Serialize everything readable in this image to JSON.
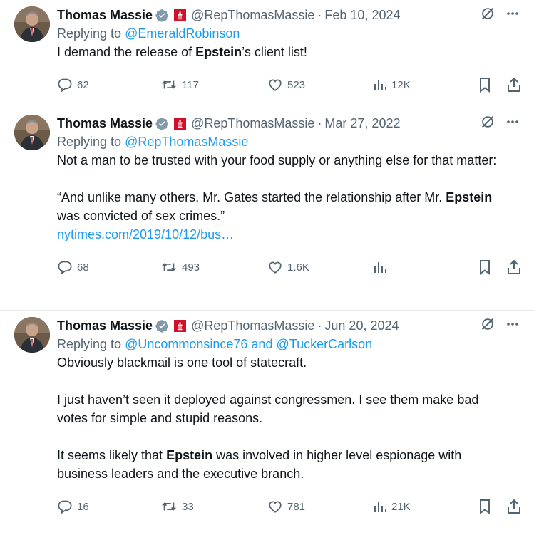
{
  "tweets": [
    {
      "name": "Thomas Massie",
      "handle": "@RepThomasMassie",
      "sep": "·",
      "date": "Feb 10, 2024",
      "replying_prefix": "Replying to ",
      "replying_to": "@EmeraldRobinson",
      "replying_and": "",
      "replying_to_2": "",
      "paragraphs": [
        [
          {
            "t": "I demand the release of "
          },
          {
            "t": "Epstein",
            "b": true
          },
          {
            "t": "’s client list!"
          }
        ]
      ],
      "replies": "62",
      "retweets": "117",
      "likes": "523",
      "views": "12K"
    },
    {
      "name": "Thomas Massie",
      "handle": "@RepThomasMassie",
      "sep": "·",
      "date": "Mar 27, 2022",
      "replying_prefix": "Replying to ",
      "replying_to": "@RepThomasMassie",
      "replying_and": "",
      "replying_to_2": "",
      "paragraphs": [
        [
          {
            "t": "Not a man to be trusted with your food supply or anything else for that matter:"
          }
        ],
        [
          {
            "t": "“And unlike many others, Mr. Gates started the relationship after Mr. "
          },
          {
            "t": "Epstein",
            "b": true
          },
          {
            "t": " was convicted of sex crimes.”"
          },
          {
            "br": true
          },
          {
            "t": "nytimes.com/2019/10/12/bus…",
            "link": true
          }
        ]
      ],
      "replies": "68",
      "retweets": "493",
      "likes": "1.6K",
      "views": ""
    },
    {
      "name": "Thomas Massie",
      "handle": "@RepThomasMassie",
      "sep": "·",
      "date": "Jun 20, 2024",
      "replying_prefix": "Replying to ",
      "replying_to": "@Uncommonsince76",
      "replying_and": " and ",
      "replying_to_2": "@TuckerCarlson",
      "paragraphs": [
        [
          {
            "t": "Obviously blackmail is one tool of statecraft."
          }
        ],
        [
          {
            "t": "I just haven’t seen it deployed against congressmen. I see them make bad votes for simple and stupid reasons."
          }
        ],
        [
          {
            "t": "It seems likely that "
          },
          {
            "t": "Epstein",
            "b": true
          },
          {
            "t": " was involved in higher level espionage with business leaders and the executive branch."
          }
        ]
      ],
      "replies": "16",
      "retweets": "33",
      "likes": "781",
      "views": "21K"
    }
  ],
  "icons": {
    "verified": "verified-badge-icon",
    "flag": "us-congress-flag-icon",
    "grok": "grok-icon",
    "more": "more-icon",
    "reply": "reply-icon",
    "retweet": "retweet-icon",
    "like": "like-icon",
    "views": "views-icon",
    "bookmark": "bookmark-icon",
    "share": "share-icon"
  },
  "colors": {
    "text": "#0f1419",
    "secondary": "#536471",
    "link": "#1d9bf0",
    "verified": "#829aab",
    "flag": "#d0112b",
    "divider": "#e7e9ea"
  }
}
